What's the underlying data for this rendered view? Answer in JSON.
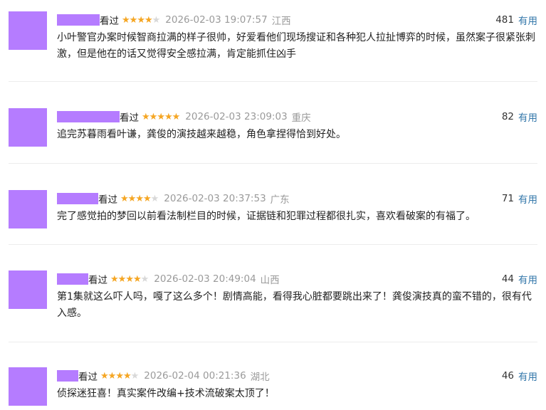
{
  "colors": {
    "avatar": "#b57cff",
    "star_on": "#f5a623",
    "star_off": "#d8d8d8",
    "link": "#3377aa",
    "meta": "#9a9a9a"
  },
  "comments": [
    {
      "status": "看过",
      "rating": 4,
      "time": "2026-02-03 19:07:57",
      "location": "江西",
      "votes": "481",
      "useful_label": "有用",
      "text": "小叶警官办案时候智商拉满的样子很帅，好爱看他们现场搜证和各种犯人拉扯博弈的时候，虽然案子很紧张刺激，但是他在的话又觉得安全感拉满，肯定能抓住凶手"
    },
    {
      "status": "看过",
      "rating": 5,
      "time": "2026-02-03 23:09:03",
      "location": "重庆",
      "votes": "82",
      "useful_label": "有用",
      "text": "追完苏暮雨看叶谦，龚俊的演技越来越稳，角色拿捏得恰到好处。"
    },
    {
      "status": "看过",
      "rating": 4,
      "time": "2026-02-03 20:37:53",
      "location": "广东",
      "votes": "71",
      "useful_label": "有用",
      "text": "完了感觉拍的梦回以前看法制栏目的时候，证据链和犯罪过程都很扎实，喜欢看破案的有福了。"
    },
    {
      "status": "看过",
      "rating": 4,
      "time": "2026-02-03 20:49:04",
      "location": "山西",
      "votes": "44",
      "useful_label": "有用",
      "text": "第1集就这么吓人吗，嘎了这么多个！剧情高能，看得我心脏都要跳出来了！龚俊演技真的蛮不错的，很有代入感。"
    },
    {
      "status": "看过",
      "rating": 4,
      "time": "2026-02-04 00:21:36",
      "location": "湖北",
      "votes": "46",
      "useful_label": "有用",
      "text": "侦探迷狂喜！真实案件改编+技术流破案太顶了！"
    }
  ]
}
